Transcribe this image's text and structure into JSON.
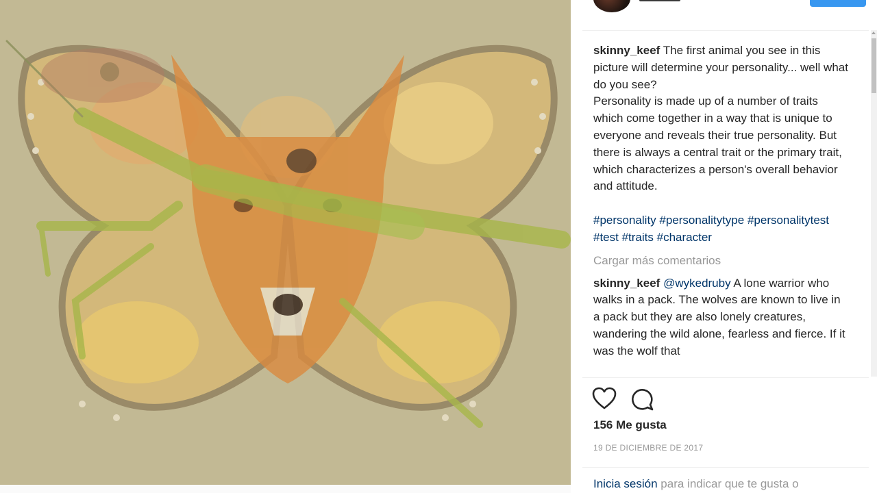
{
  "post": {
    "image_alt": "Optical illusion: fox, mantis, butterfly and flowers overlaid",
    "caption": {
      "username": "skinny_keef",
      "text": "The first animal you see in this picture will determine your personality... well what do you see?",
      "paragraph": "Personality is made up of a number of traits which come together in a way that is unique to everyone and reveals their true personality. But there is always a central trait or the primary trait, which characterizes a person's overall behavior and attitude.",
      "hashtags": [
        "#personality",
        "#personalitytype",
        "#personalitytest",
        "#test",
        "#traits",
        "#character"
      ]
    },
    "load_more_label": "Cargar más comentarios",
    "comment": {
      "username": "skinny_keef",
      "mention": "@wykedruby",
      "text": "A lone warrior who walks in a pack. The wolves are known to live in a pack but they are also lonely creatures, wandering the wild alone, fearless and fierce. If it was the wolf that"
    },
    "likes": "156 Me gusta",
    "date": "19 DE DICIEMBRE DE 2017",
    "login": {
      "link": "Inicia sesión",
      "rest": "para indicar que te gusta o"
    }
  },
  "icons": {
    "like": "heart-icon",
    "comment": "comment-icon"
  },
  "colors": {
    "image_background": "#c2b994",
    "link": "#003569",
    "muted": "#999999",
    "text": "#262626",
    "follow_button": "#3897f0"
  }
}
